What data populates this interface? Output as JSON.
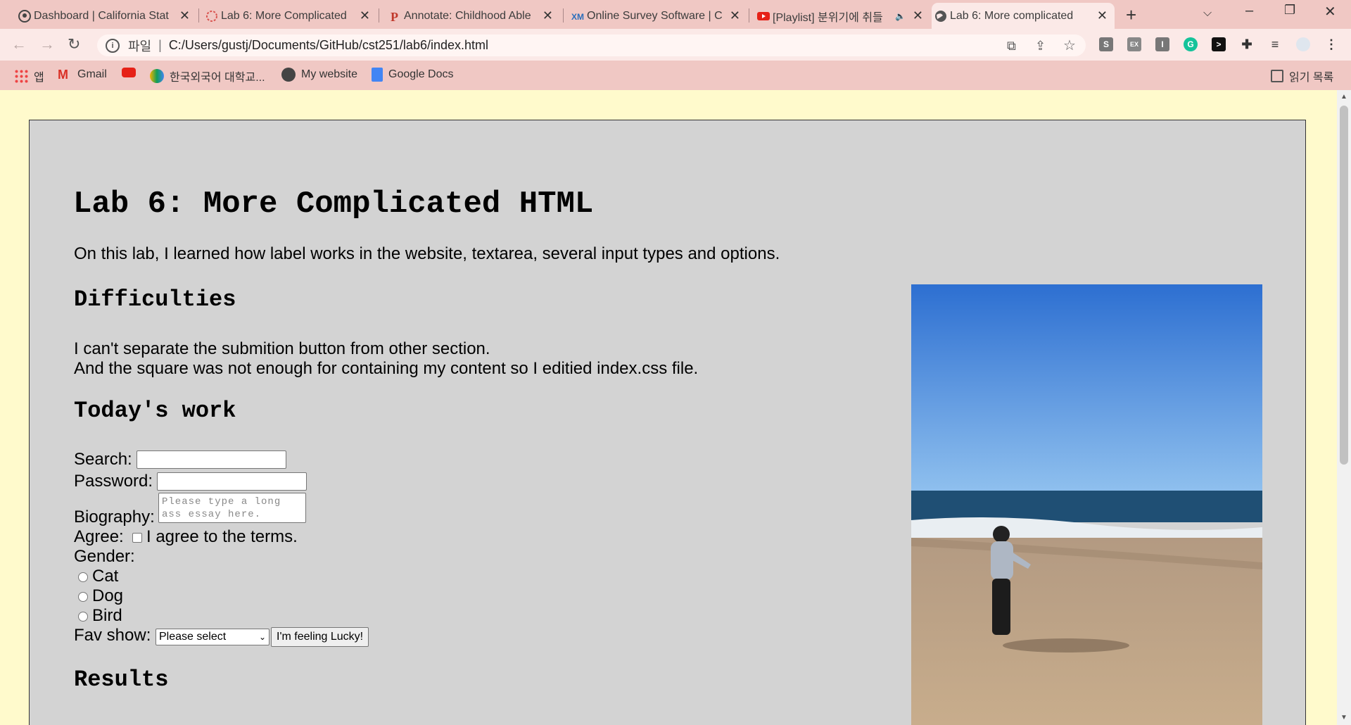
{
  "browser": {
    "tabs": [
      {
        "title": "Dashboard | California Stat"
      },
      {
        "title": "Lab 6: More Complicated"
      },
      {
        "title": "Annotate: Childhood Able"
      },
      {
        "title": "Online Survey Software | C"
      },
      {
        "title": "[Playlist] 분위기에 취들"
      },
      {
        "title": "Lab 6: More complicated"
      }
    ],
    "address": {
      "scheme": "파일",
      "url": "C:/Users/gustj/Documents/GitHub/cst251/lab6/index.html"
    },
    "bookmarks": [
      "앱",
      "Gmail",
      "",
      "한국외국어 대학교...",
      "My website",
      "Google Docs"
    ],
    "reading_list": "읽기 목록"
  },
  "page": {
    "title": "Lab 6: More Complicated HTML",
    "intro": "On this lab, I learned how label works in the website, textarea, several input types and options.",
    "difficulties_heading": "Difficulties",
    "difficulties_lines": [
      "I can't separate the submition button from other section.",
      "And the square was not enough for containing my content so I editied index.css file."
    ],
    "work_heading": "Today's work",
    "form": {
      "search_label": "Search:",
      "password_label": "Password:",
      "bio_label": "Biography:",
      "bio_placeholder": "Please type a long ass essay here.",
      "agree_label": "Agree:",
      "agree_text": "I agree to the terms.",
      "gender_label": "Gender:",
      "genders": [
        "Cat",
        "Dog",
        "Bird"
      ],
      "favshow_label": "Fav show:",
      "favshow_selected": "Please select",
      "submit_label": "I'm feeling Lucky!"
    },
    "results_heading": "Results"
  },
  "colors": {
    "chrome": "#f0c8c4",
    "page_bg": "#fffacc",
    "card_bg": "#d3d3d3"
  }
}
